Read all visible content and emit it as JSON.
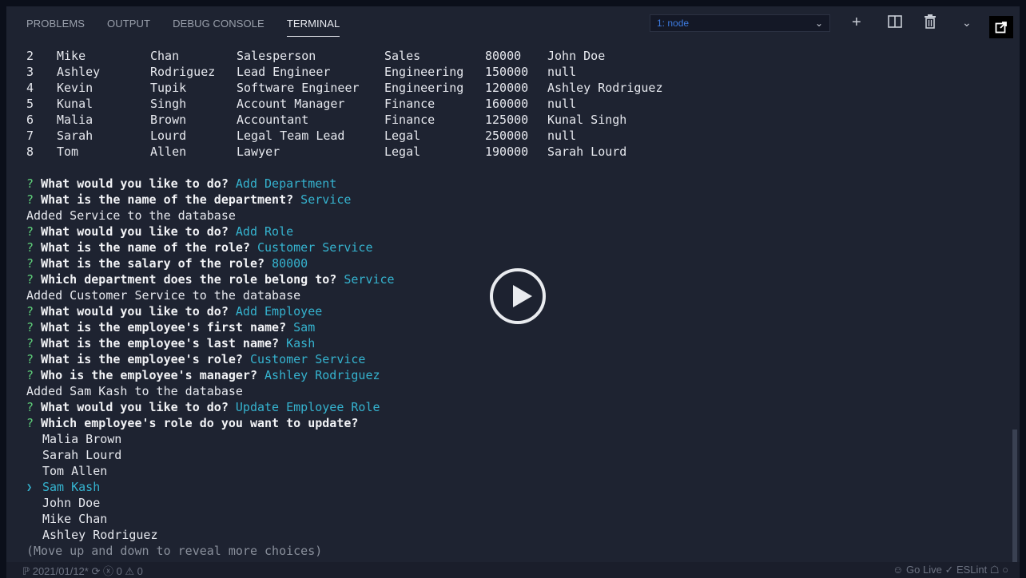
{
  "panel": {
    "tabs": [
      "PROBLEMS",
      "OUTPUT",
      "DEBUG CONSOLE",
      "TERMINAL"
    ],
    "active_tab": "TERMINAL",
    "terminal_select": "1: node",
    "icons": [
      "plus-icon",
      "split-icon",
      "trash-icon",
      "chevron-down-icon",
      "popout-icon"
    ]
  },
  "employees": [
    {
      "id": "2",
      "first": "Mike",
      "last": "Chan",
      "title": "Salesperson",
      "dept": "Sales",
      "salary": "80000",
      "manager": "John Doe"
    },
    {
      "id": "3",
      "first": "Ashley",
      "last": "Rodriguez",
      "title": "Lead Engineer",
      "dept": "Engineering",
      "salary": "150000",
      "manager": "null"
    },
    {
      "id": "4",
      "first": "Kevin",
      "last": "Tupik",
      "title": "Software Engineer",
      "dept": "Engineering",
      "salary": "120000",
      "manager": "Ashley Rodriguez"
    },
    {
      "id": "5",
      "first": "Kunal",
      "last": "Singh",
      "title": "Account Manager",
      "dept": "Finance",
      "salary": "160000",
      "manager": "null"
    },
    {
      "id": "6",
      "first": "Malia",
      "last": "Brown",
      "title": "Accountant",
      "dept": "Finance",
      "salary": "125000",
      "manager": "Kunal Singh"
    },
    {
      "id": "7",
      "first": "Sarah",
      "last": "Lourd",
      "title": "Legal Team Lead",
      "dept": "Legal",
      "salary": "250000",
      "manager": "null"
    },
    {
      "id": "8",
      "first": "Tom",
      "last": "Allen",
      "title": "Lawyer",
      "dept": "Legal",
      "salary": "190000",
      "manager": "Sarah Lourd"
    }
  ],
  "log": [
    {
      "kind": "q",
      "text": "What would you like to do?",
      "answer": "Add Department"
    },
    {
      "kind": "q",
      "text": "What is the name of the department?",
      "answer": "Service"
    },
    {
      "kind": "plain",
      "text": "Added Service to the database"
    },
    {
      "kind": "q",
      "text": "What would you like to do?",
      "answer": "Add Role"
    },
    {
      "kind": "q",
      "text": "What is the name of the role?",
      "answer": "Customer Service"
    },
    {
      "kind": "q",
      "text": "What is the salary of the role?",
      "answer": "80000"
    },
    {
      "kind": "q",
      "text": "Which department does the role belong to?",
      "answer": "Service"
    },
    {
      "kind": "plain",
      "text": "Added Customer Service to the database"
    },
    {
      "kind": "q",
      "text": "What would you like to do?",
      "answer": "Add Employee"
    },
    {
      "kind": "q",
      "text": "What is the employee's first name?",
      "answer": "Sam"
    },
    {
      "kind": "q",
      "text": "What is the employee's last name?",
      "answer": "Kash"
    },
    {
      "kind": "q",
      "text": "What is the employee's role?",
      "answer": "Customer Service"
    },
    {
      "kind": "q",
      "text": "Who is the employee's manager?",
      "answer": "Ashley Rodriguez"
    },
    {
      "kind": "plain",
      "text": "Added Sam Kash to the database"
    },
    {
      "kind": "q",
      "text": "What would you like to do?",
      "answer": "Update Employee Role"
    },
    {
      "kind": "q",
      "text": "Which employee's role do you want to update?",
      "answer": ""
    }
  ],
  "choices": [
    "Malia Brown",
    "Sarah Lourd",
    "Tom Allen",
    "Sam Kash",
    "John Doe",
    "Mike Chan",
    "Ashley Rodriguez"
  ],
  "selected_choice": "Sam Kash",
  "hint": "(Move up and down to reveal more choices)",
  "statusbar": {
    "left": "ℙ 2021/01/12*   ⟳   ⓧ 0 ⚠ 0",
    "right": "☺ Go Live   ✓ ESLint   ☖   ○"
  }
}
